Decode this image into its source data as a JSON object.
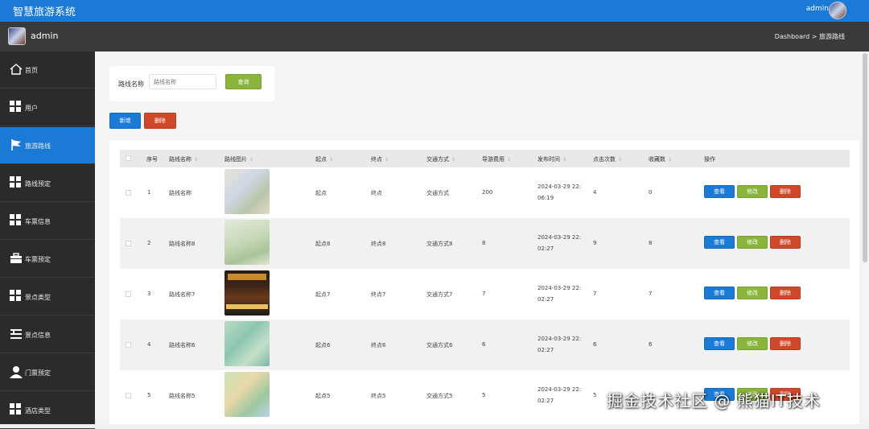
{
  "app": {
    "title": "智慧旅游系统",
    "user": "admin"
  },
  "subbar": {
    "brand": "admin",
    "breadcrumb": "Dashboard > 旅游路线"
  },
  "sidebar": {
    "items": [
      {
        "label": "首页",
        "icon": "home-icon"
      },
      {
        "label": "用户",
        "icon": "grid-icon"
      },
      {
        "label": "旅游路线",
        "icon": "flag-icon",
        "active": true
      },
      {
        "label": "路线预定",
        "icon": "grid-icon"
      },
      {
        "label": "车票信息",
        "icon": "grid-icon"
      },
      {
        "label": "车票预定",
        "icon": "briefcase-icon"
      },
      {
        "label": "景点类型",
        "icon": "grid-icon"
      },
      {
        "label": "景点信息",
        "icon": "list-icon"
      },
      {
        "label": "门票预定",
        "icon": "user-icon"
      },
      {
        "label": "酒店类型",
        "icon": "grid-icon"
      }
    ]
  },
  "search": {
    "label": "路线名称",
    "placeholder": "路线名称",
    "button": "查询"
  },
  "actions": {
    "add": "新增",
    "delete": "删除"
  },
  "table": {
    "headers": [
      "序号",
      "路线名称",
      "路线图片",
      "起点",
      "终点",
      "交通方式",
      "导游费用",
      "发布时间",
      "点击次数",
      "收藏数",
      "操作"
    ],
    "row_actions": {
      "view": "查看",
      "edit": "修改",
      "delete": "删除"
    },
    "rows": [
      {
        "no": "1",
        "name": "路线名称",
        "start": "起点",
        "end": "终点",
        "transport": "交通方式",
        "fee": "200",
        "time1": "2024-03-29 22:",
        "time2": "06:19",
        "clicks": "4",
        "favs": "0"
      },
      {
        "no": "2",
        "name": "路线名称8",
        "start": "起点8",
        "end": "终点8",
        "transport": "交通方式8",
        "fee": "8",
        "time1": "2024-03-29 22:",
        "time2": "02:27",
        "clicks": "9",
        "favs": "8"
      },
      {
        "no": "3",
        "name": "路线名称7",
        "start": "起点7",
        "end": "终点7",
        "transport": "交通方式7",
        "fee": "7",
        "time1": "2024-03-29 22:",
        "time2": "02:27",
        "clicks": "7",
        "favs": "7"
      },
      {
        "no": "4",
        "name": "路线名称6",
        "start": "起点6",
        "end": "终点6",
        "transport": "交通方式6",
        "fee": "6",
        "time1": "2024-03-29 22:",
        "time2": "02:27",
        "clicks": "6",
        "favs": "6"
      },
      {
        "no": "5",
        "name": "路线名称5",
        "start": "起点5",
        "end": "终点5",
        "transport": "交通方式5",
        "fee": "5",
        "time1": "2024-03-29 22:",
        "time2": "02:27",
        "clicks": "5",
        "favs": "5"
      }
    ]
  },
  "watermark": "掘金技术社区 @ 熊猫IT技术",
  "colors": {
    "primary": "#1a7ad6",
    "success": "#8ab43c",
    "danger": "#d0482a",
    "sidebar": "#2b2b2b",
    "header_dark": "#3a3a3a"
  }
}
